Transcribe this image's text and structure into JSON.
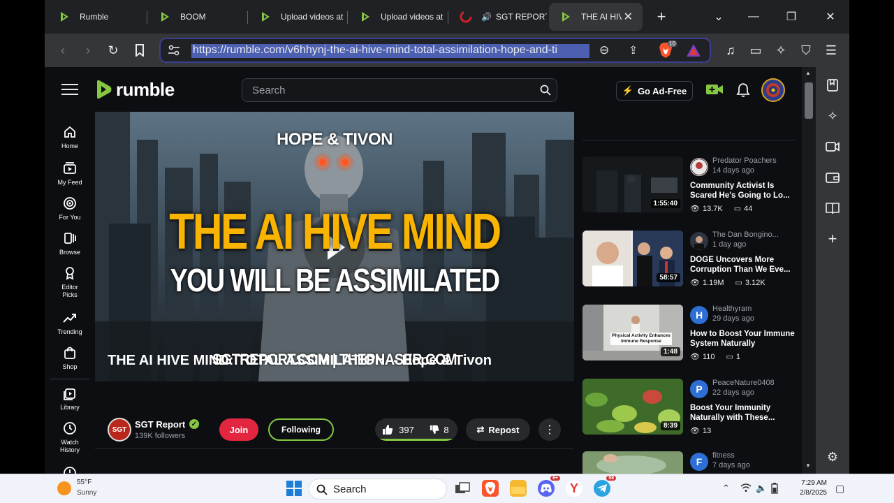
{
  "browser": {
    "tabs": [
      {
        "label": "Rumble"
      },
      {
        "label": "BOOM"
      },
      {
        "label": "Upload videos at"
      },
      {
        "label": "Upload videos at"
      },
      {
        "label": "SGT REPORT"
      },
      {
        "label": "THE AI HIVE"
      }
    ],
    "url": "https://rumble.com/v6hhynj-the-ai-hive-mind-total-assimilation-hope-and-ti",
    "brave_badge": "10"
  },
  "site": {
    "logo_text": "rumble",
    "search_placeholder": "Search",
    "go_ad_free": "Go Ad-Free"
  },
  "nav": [
    {
      "label": "Home",
      "icon": "home-icon"
    },
    {
      "label": "My Feed",
      "icon": "feed-icon"
    },
    {
      "label": "For You",
      "icon": "for-you-icon"
    },
    {
      "label": "Browse",
      "icon": "browse-icon"
    },
    {
      "label": "Editor Picks",
      "icon": "editor-picks-icon"
    },
    {
      "label": "Trending",
      "icon": "trending-icon"
    },
    {
      "label": "Shop",
      "icon": "shop-icon"
    },
    {
      "label": "Library",
      "icon": "library-icon"
    },
    {
      "label": "Watch History",
      "icon": "history-icon"
    }
  ],
  "video": {
    "thumb_top_text": "HOPE & TIVON",
    "thumb_main_text": "THE AI HIVE MIND",
    "thumb_sub_text": "YOU WILL BE ASSIMILATED",
    "thumb_bottom_text": "SGTREPORT.COM | THEPHASER.COM",
    "title": "THE AI HIVE MIND: TOTAL ASSIMILATION -- Hope & Tivon",
    "channel": "SGT Report",
    "channel_avatar_text": "SGT",
    "followers": "139K followers",
    "join": "Join",
    "following": "Following",
    "likes": "397",
    "dislikes": "8",
    "repost": "Repost"
  },
  "recommendations": [
    {
      "channel": "Predator Poachers",
      "ago": "14 days ago",
      "title": "Community Activist Is Scared He's Going to Lo...",
      "duration": "1:55:40",
      "views": "13.7K",
      "comments": "44",
      "avatar": "",
      "avatar_color": "#5a3a3a"
    },
    {
      "channel": "The Dan Bongino...",
      "ago": "1 day ago",
      "title": "DOGE Uncovers More Corruption Than We Eve...",
      "duration": "58:57",
      "views": "1.19M",
      "comments": "3.12K",
      "avatar": "",
      "avatar_color": "#2f3540"
    },
    {
      "channel": "Healthyram",
      "ago": "29 days ago",
      "title": "How to Boost Your Immune System Naturally",
      "duration": "1:48",
      "views": "110",
      "comments": "1",
      "avatar": "H",
      "avatar_color": "#2d6fd6",
      "thumb_caption": "Physical Activity Enhances Immune Response"
    },
    {
      "channel": "PeaceNature0408",
      "ago": "22 days ago",
      "title": "Boost Your Immunity Naturally with These...",
      "duration": "8:39",
      "views": "13",
      "comments": "",
      "avatar": "P",
      "avatar_color": "#2d6fd6"
    },
    {
      "channel": "fitness",
      "ago": "7 days ago",
      "title": "",
      "duration": "",
      "views": "",
      "comments": "",
      "avatar": "F",
      "avatar_color": "#2d6fd6"
    }
  ],
  "taskbar": {
    "temp": "55°F",
    "condition": "Sunny",
    "search_placeholder": "Search",
    "time": "7:29 AM",
    "date": "2/8/2025",
    "discord_badge": "9+",
    "telegram_badge": "58"
  },
  "colors": {
    "rumble_green": "#85c742",
    "join_red": "#e3263f",
    "page_bg": "#0d0e12"
  }
}
